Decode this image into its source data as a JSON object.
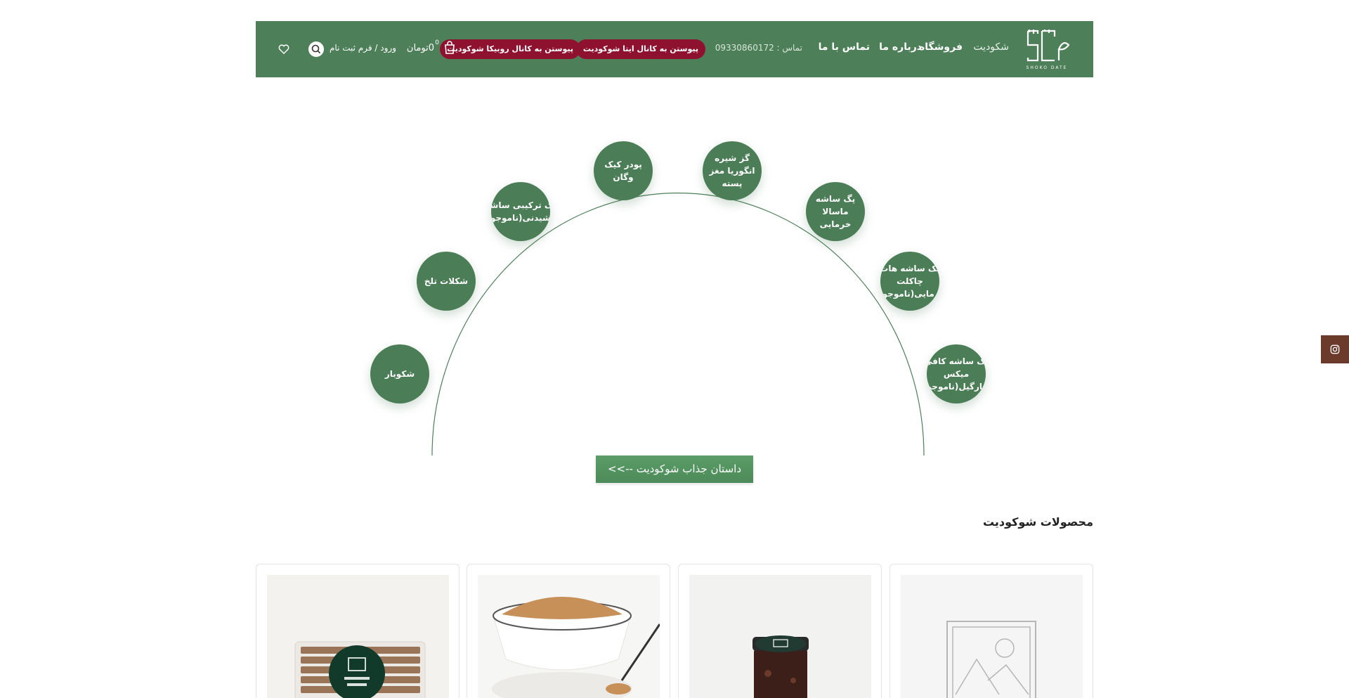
{
  "header": {
    "logo_text": "SHOKO DATE",
    "nav": {
      "home": "شکودیت",
      "shop": "فروشگاه",
      "about": "درباره ما",
      "contact": "تماس با ما"
    },
    "phone": "تماس : 09330860172",
    "join_eitaa": "پیوستن به کانال ایتا شوکودیت",
    "join_rubika": "پیوستن به کانال روبیکا شوکودیت",
    "cart_count": "0",
    "cart_total": "0تومان",
    "login": "ورود / فرم ثبت نام"
  },
  "categories": [
    "شکوبار",
    "شکلات تلخ",
    "پک ترکیبی ساشه نوشیدنی(ناموجود)",
    "پودر کیک وگان",
    "گز شیره انگوریا مغز پسته",
    "پگ ساشه ماسالا خرمایی",
    "پک ساشه هات چاکلت خرمایی(ناموجود)",
    "پک ساشه کافی میکس مانارگیل(ناموجود)"
  ],
  "story_button": "داستان جذاب شوکودیت -->>",
  "products_title": "محصولات شوکودیت",
  "colors": {
    "brand_green": "#4d7f58",
    "pill_red": "#8e1230",
    "button_green": "#5b9c68",
    "instagram_tab": "#6b3a2a"
  },
  "icons": [
    "logo-icon",
    "cart-icon",
    "search-icon",
    "heart-icon",
    "instagram-icon",
    "placeholder-image-icon"
  ]
}
